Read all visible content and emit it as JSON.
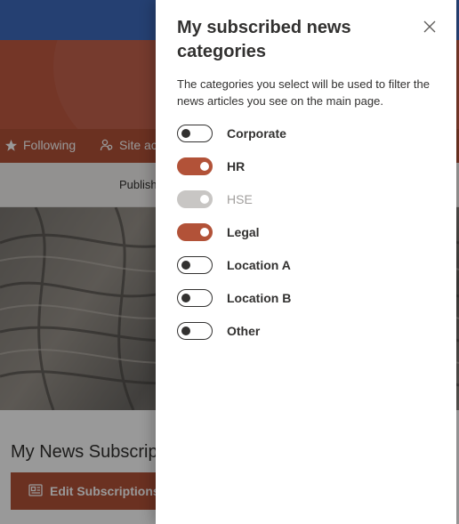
{
  "colors": {
    "accent": "#b25238",
    "suite_bar": "#3f6cbf",
    "hero": "#c25a42",
    "disabled": "#c8c6c4",
    "text": "#323130"
  },
  "site_nav": {
    "following_label": "Following",
    "following_icon": "star-icon",
    "site_access_label": "Site ac",
    "site_access_icon": "people-icon"
  },
  "command_bar": {
    "publish_label": "Publish"
  },
  "webpart": {
    "title": "My News Subscrip",
    "edit_button_label": "Edit Subscriptions",
    "edit_button_icon": "news-icon"
  },
  "panel": {
    "title": "My subscribed news categories",
    "close_icon": "close-icon",
    "description": "The categories you select will be used to filter the news articles you see on the main page.",
    "categories": [
      {
        "label": "Corporate",
        "state": "off"
      },
      {
        "label": "HR",
        "state": "on"
      },
      {
        "label": "HSE",
        "state": "disabled-on"
      },
      {
        "label": "Legal",
        "state": "on"
      },
      {
        "label": "Location A",
        "state": "off"
      },
      {
        "label": "Location B",
        "state": "off"
      },
      {
        "label": "Other",
        "state": "off"
      }
    ]
  }
}
